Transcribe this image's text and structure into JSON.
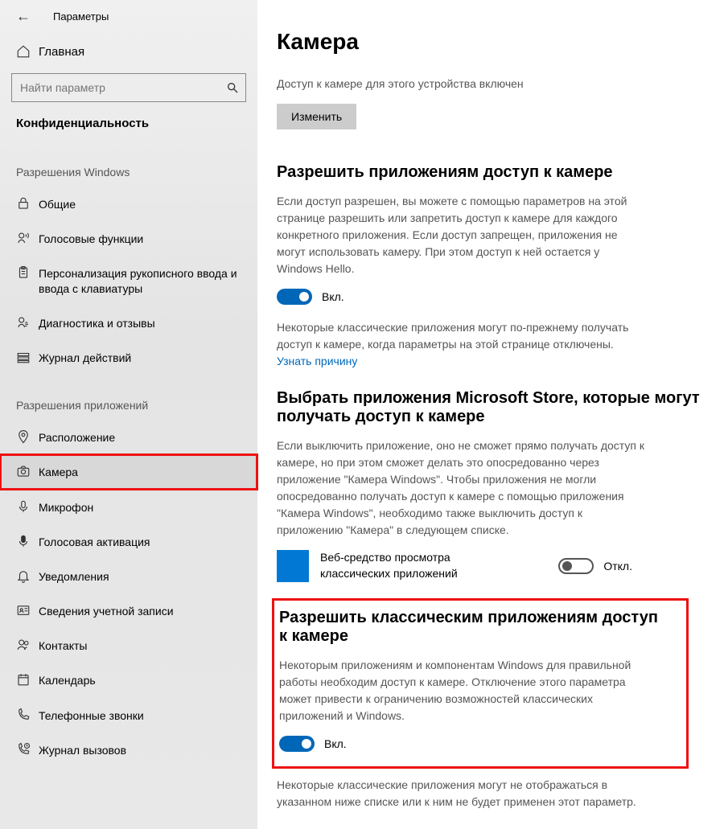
{
  "header": {
    "back_glyph": "←",
    "title": "Параметры"
  },
  "home": {
    "label": "Главная"
  },
  "search": {
    "placeholder": "Найти параметр"
  },
  "privacy_label": "Конфиденциальность",
  "group1": {
    "title": "Разрешения Windows",
    "items": [
      {
        "icon": "lock",
        "label": "Общие"
      },
      {
        "icon": "speech",
        "label": "Голосовые функции"
      },
      {
        "icon": "clipboard",
        "label": "Персонализация рукописного ввода и ввода с клавиатуры"
      },
      {
        "icon": "diag",
        "label": "Диагностика и отзывы"
      },
      {
        "icon": "journal",
        "label": "Журнал действий"
      }
    ]
  },
  "group2": {
    "title": "Разрешения приложений",
    "items": [
      {
        "icon": "location",
        "label": "Расположение"
      },
      {
        "icon": "camera",
        "label": "Камера",
        "selected": true
      },
      {
        "icon": "mic",
        "label": "Микрофон"
      },
      {
        "icon": "voice",
        "label": "Голосовая активация"
      },
      {
        "icon": "bell",
        "label": "Уведомления"
      },
      {
        "icon": "account",
        "label": "Сведения учетной записи"
      },
      {
        "icon": "contacts",
        "label": "Контакты"
      },
      {
        "icon": "calendar",
        "label": "Календарь"
      },
      {
        "icon": "phone",
        "label": "Телефонные звонки"
      },
      {
        "icon": "calllog",
        "label": "Журнал вызовов"
      }
    ]
  },
  "content": {
    "title": "Камера",
    "device_access": "Доступ к камере для этого устройства включен",
    "change_btn": "Изменить",
    "allow_apps_h": "Разрешить приложениям доступ к камере",
    "allow_apps_p": "Если доступ разрешен, вы можете с помощью параметров на этой странице разрешить или запретить доступ к камере для каждого конкретного приложения. Если доступ запрещен, приложения не могут использовать камеру. При этом доступ к ней остается у Windows Hello.",
    "on_label": "Вкл.",
    "off_label": "Откл.",
    "classic_note": "Некоторые классические приложения могут по-прежнему получать доступ к камере, когда параметры на этой странице отключены. ",
    "learn_link": "Узнать причину",
    "store_h": "Выбрать приложения Microsoft Store, которые могут получать доступ к камере",
    "store_p": "Если выключить приложение, оно не сможет прямо получать доступ к камере, но при этом сможет делать это опосредованно через приложение \"Камера Windows\". Чтобы приложения не могли опосредованно получать доступ к камере с помощью приложения \"Камера Windows\", необходимо также выключить доступ к приложению \"Камера\" в следующем списке.",
    "app1": "Веб-средство просмотра классических приложений",
    "desktop_h": "Разрешить классическим приложениям доступ к камере",
    "desktop_p": "Некоторым приложениям и компонентам Windows для правильной работы необходим доступ к камере. Отключение этого параметра может привести к ограничению возможностей классических приложений и Windows.",
    "footer_note": "Некоторые классические приложения могут не отображаться в указанном ниже списке или к ним не будет применен этот параметр."
  }
}
